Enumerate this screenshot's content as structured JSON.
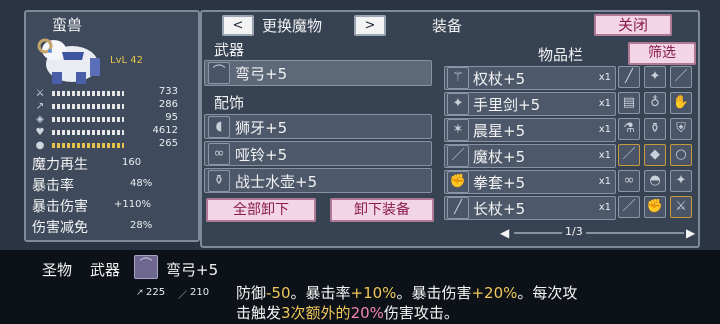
{
  "monster": {
    "name": "蛮兽",
    "level": "LvL 42",
    "stats": [
      {
        "icon": "sword-icon",
        "value": "733"
      },
      {
        "icon": "bow-icon",
        "value": "286"
      },
      {
        "icon": "shield-icon",
        "value": "95"
      },
      {
        "icon": "heart-icon",
        "value": "4612"
      },
      {
        "icon": "coin-icon",
        "value": "265"
      }
    ],
    "regen_label": "魔力再生",
    "regen_value": "160",
    "crit_label": "暴击率",
    "crit_value": "48%",
    "critdmg_label": "暴击伤害",
    "critdmg_value": "+110%",
    "reduction_label": "伤害减免",
    "reduction_value": "28%"
  },
  "header": {
    "prev": "<",
    "title": "更换魔物",
    "next": ">",
    "equip_title": "装备",
    "close": "关闭"
  },
  "equip": {
    "weapon_label": "武器",
    "weapon_item": "弯弓+5",
    "accessory_label": "配饰",
    "accessories": [
      "狮牙+5",
      "哑铃+5",
      "战士水壶+5"
    ],
    "unequip_all": "全部卸下",
    "unequip": "卸下装备"
  },
  "inventory": {
    "title": "物品栏",
    "filter": "筛选",
    "items": [
      {
        "name": "权杖+5",
        "qty": "x1"
      },
      {
        "name": "手里剑+5",
        "qty": "x1"
      },
      {
        "name": "晨星+5",
        "qty": "x1"
      },
      {
        "name": "魔杖+5",
        "qty": "x1"
      },
      {
        "name": "拳套+5",
        "qty": "x1"
      },
      {
        "name": "长杖+5",
        "qty": "x1"
      }
    ],
    "page": "1/3",
    "prev_arrow": "◀",
    "next_arrow": "▶"
  },
  "tooltip": {
    "category": "圣物",
    "slot": "武器",
    "item": "弯弓+5",
    "atk": "225",
    "matk": "210",
    "line1_a": "防御",
    "line1_b": "-50",
    "line1_c": "。暴击率",
    "line1_d": "+10%",
    "line1_e": "。暴击伤害",
    "line1_f": "+20%",
    "line1_g": "。每次攻",
    "line2_a": "击触发",
    "line2_b": "3次额外的",
    "line2_c": "20%",
    "line2_d": "伤害攻击。"
  },
  "colors": {
    "accent_pink": "#f087b7",
    "accent_gold": "#f0c85a",
    "panel": "#3f4b5c"
  }
}
